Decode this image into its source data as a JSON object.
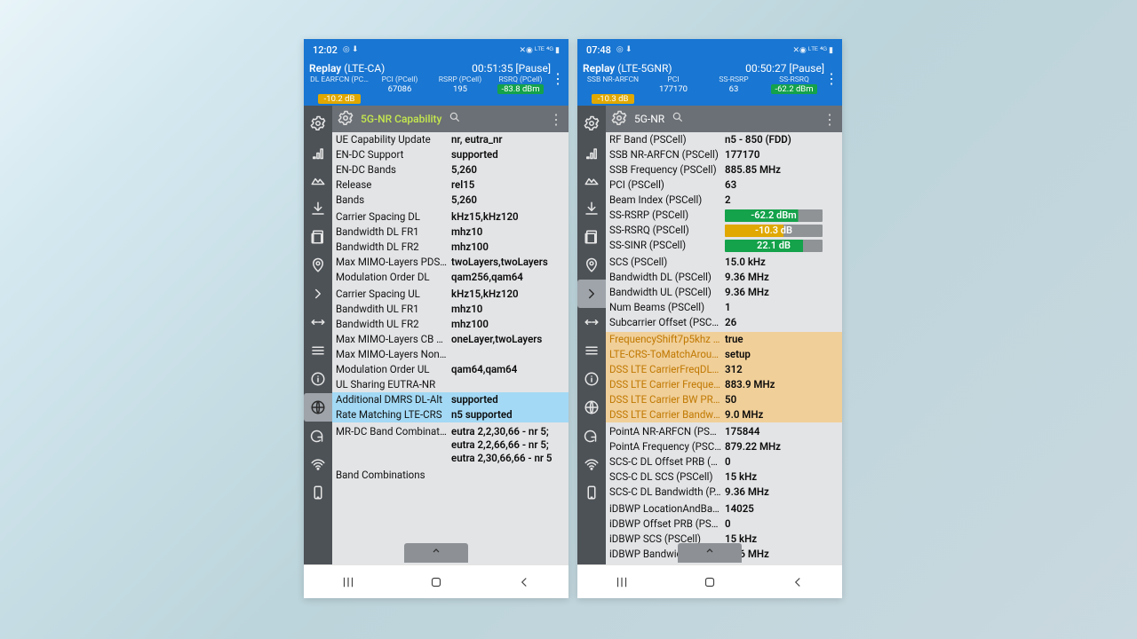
{
  "phones": [
    {
      "statusbar": {
        "time": "12:02",
        "left_icons": "◎ ⬇",
        "right_icons": "✕◉ ᴸᵀᴱ ⁴ᴳ ▮"
      },
      "appbar": {
        "title": "Replay",
        "subtitle": "(LTE-CA)",
        "timer": "00:51:35 [Pause]",
        "cols": [
          {
            "hdr": "DL EARFCN (PC…",
            "val": "67086",
            "cls": ""
          },
          {
            "hdr": "PCI (PCell)",
            "val": "195",
            "cls": ""
          },
          {
            "hdr": "RSRP (PCell)",
            "val": "-83.8 dBm",
            "cls": "green"
          },
          {
            "hdr": "RSRQ (PCell)",
            "val": "-10.2 dB",
            "cls": "yellow"
          }
        ]
      },
      "search": {
        "tab": "5G-NR Capability",
        "active": true
      },
      "rail_selected": 10,
      "rows": [
        {
          "k": "UE Capability Update",
          "v": "nr, eutra_nr"
        },
        {
          "k": "EN-DC Support",
          "v": "supported"
        },
        {
          "k": "EN-DC Bands",
          "v": "5,260"
        },
        {
          "k": "Release",
          "v": "rel15"
        },
        {
          "k": "Bands",
          "v": "5,260"
        },
        {
          "sep": true
        },
        {
          "k": "Carrier Spacing DL",
          "v": "kHz15,kHz120"
        },
        {
          "k": "Bandwidth DL FR1",
          "v": "mhz10"
        },
        {
          "k": "Bandwidth DL FR2",
          "v": "mhz100"
        },
        {
          "k": "Max MIMO-Layers PDSC…",
          "v": "twoLayers,twoLayers"
        },
        {
          "k": "Modulation Order DL",
          "v": "qam256,qam64"
        },
        {
          "sep": true
        },
        {
          "k": "Carrier Spacing UL",
          "v": "kHz15,kHz120"
        },
        {
          "k": "Bandwdith UL FR1",
          "v": "mhz10"
        },
        {
          "k": "Bandwidth UL FR2",
          "v": "mhz100"
        },
        {
          "k": "Max MIMO-Layers CB P…",
          "v": "oneLayer,twoLayers"
        },
        {
          "k": "Max MIMO-Layers NonC…",
          "v": ""
        },
        {
          "k": "Modulation Order UL",
          "v": "qam64,qam64"
        },
        {
          "k": "UL Sharing EUTRA-NR",
          "v": ""
        },
        {
          "k": "Additional DMRS DL-Alt",
          "v": "supported",
          "hl": "blue"
        },
        {
          "k": "Rate Matching LTE-CRS",
          "v": "n5 supported",
          "hl": "blue"
        },
        {
          "sep": true
        },
        {
          "k": "MR-DC Band Combinati…",
          "v": "eutra 2,2,30,66 - nr 5;\neutra 2,2,66,66 - nr 5;\neutra 2,30,66,66 - nr 5"
        },
        {
          "sep": true
        },
        {
          "k": "Band Combinations",
          "v": ""
        }
      ]
    },
    {
      "statusbar": {
        "time": "07:48",
        "left_icons": "◎ ⬇",
        "right_icons": "✕◉ ᴸᵀᴱ ⁴ᴳ ▮"
      },
      "appbar": {
        "title": "Replay",
        "subtitle": "(LTE-5GNR)",
        "timer": "00:50:27 [Pause]",
        "cols": [
          {
            "hdr": "SSB NR-ARFCN",
            "val": "177170",
            "cls": ""
          },
          {
            "hdr": "PCI",
            "val": "63",
            "cls": ""
          },
          {
            "hdr": "SS-RSRP",
            "val": "-62.2 dBm",
            "cls": "green"
          },
          {
            "hdr": "SS-RSRQ",
            "val": "-10.3 dB",
            "cls": "yellow"
          }
        ]
      },
      "search": {
        "tab": "5G-NR",
        "active": false
      },
      "rail_selected": 6,
      "rows": [
        {
          "k": "RF Band (PSCell)",
          "v": "n5 - 850 (FDD)"
        },
        {
          "k": "SSB NR-ARFCN (PSCell)",
          "v": "177170"
        },
        {
          "k": "SSB Frequency (PSCell)",
          "v": "885.85 MHz"
        },
        {
          "k": "PCI (PSCell)",
          "v": "63"
        },
        {
          "k": "Beam Index (PSCell)",
          "v": "2"
        },
        {
          "k": "SS-RSRP (PSCell)",
          "vpill": "-62.2 dBm",
          "pcls": "green"
        },
        {
          "k": "SS-RSRQ (PSCell)",
          "vpill": "-10.3 dB",
          "pcls": "yellow"
        },
        {
          "k": "SS-SINR (PSCell)",
          "vpill": "22.1 dB",
          "pcls": "green2"
        },
        {
          "sep": true
        },
        {
          "k": "SCS (PSCell)",
          "v": "15.0 kHz"
        },
        {
          "k": "Bandwidth DL (PSCell)",
          "v": "9.36 MHz"
        },
        {
          "k": "Bandwidth UL (PSCell)",
          "v": "9.36 MHz"
        },
        {
          "k": "Num Beams (PSCell)",
          "v": "1"
        },
        {
          "k": "Subcarrier Offset (PSCell)",
          "v": "26"
        },
        {
          "sep": true
        },
        {
          "k": "FrequencyShift7p5khz (…",
          "v": "true",
          "hl": "orange"
        },
        {
          "k": "LTE-CRS-ToMatchAroun…",
          "v": "setup",
          "hl": "orange"
        },
        {
          "k": "DSS LTE CarrierFreqDL (…",
          "v": "312",
          "hl": "orange"
        },
        {
          "k": "DSS LTE Carrier Frequen…",
          "v": "883.9 MHz",
          "hl": "orange"
        },
        {
          "k": "DSS LTE Carrier BW PRB…",
          "v": "50",
          "hl": "orange"
        },
        {
          "k": "DSS LTE Carrier Bandwi…",
          "v": "9.0 MHz",
          "hl": "orange"
        },
        {
          "sep": true
        },
        {
          "k": "PointA NR-ARFCN (PSC…",
          "v": "175844"
        },
        {
          "k": "PointA Frequency (PSC…",
          "v": "879.22 MHz"
        },
        {
          "k": "SCS-C DL Offset PRB (P…",
          "v": "0"
        },
        {
          "k": "SCS-C DL SCS (PSCell)",
          "v": "15 kHz"
        },
        {
          "k": "SCS-C DL Bandwidth (P…",
          "v": "9.36 MHz"
        },
        {
          "sep": true
        },
        {
          "k": "iDBWP LocationAndBan…",
          "v": "14025"
        },
        {
          "k": "iDBWP Offset PRB (PSC…",
          "v": "0"
        },
        {
          "k": "iDBWP SCS (PSCell)",
          "v": "15 kHz"
        },
        {
          "k": "iDBWP Bandwidth (PSC…",
          "v": "9.36 MHz"
        }
      ]
    }
  ],
  "rail_icons": [
    "⚙",
    "ⓘ",
    "▥",
    "⬇",
    "▤",
    "◉",
    "›",
    "⇹",
    "≡",
    "ⓘ",
    "⊚",
    "↺",
    "⌯",
    "📱"
  ],
  "nav_labels": {
    "recents": "Recents",
    "home": "Home",
    "back": "Back"
  }
}
